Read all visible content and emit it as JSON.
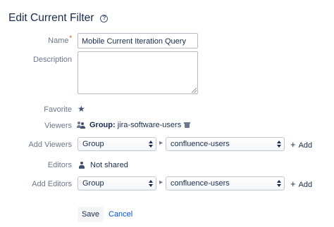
{
  "header": {
    "title": "Edit Current Filter",
    "help_icon": "question-circle-icon"
  },
  "form": {
    "name": {
      "label": "Name",
      "required_mark": "*",
      "value": "Mobile Current Iteration Query"
    },
    "description": {
      "label": "Description",
      "value": ""
    },
    "favorite": {
      "label": "Favorite",
      "icon": "star-icon"
    },
    "viewers": {
      "label": "Viewers",
      "group_prefix": "Group:",
      "group_name": "jira-software-users"
    },
    "add_viewers": {
      "label": "Add Viewers",
      "type_select": "Group",
      "value_select": "confluence-users",
      "add_label": "Add"
    },
    "editors": {
      "label": "Editors",
      "value": "Not shared"
    },
    "add_editors": {
      "label": "Add Editors",
      "type_select": "Group",
      "value_select": "confluence-users",
      "add_label": "Add"
    }
  },
  "actions": {
    "save_label": "Save",
    "cancel_label": "Cancel"
  },
  "colors": {
    "link": "#0052cc",
    "required": "#de350b",
    "label": "#6b778c",
    "text": "#172b4d"
  }
}
